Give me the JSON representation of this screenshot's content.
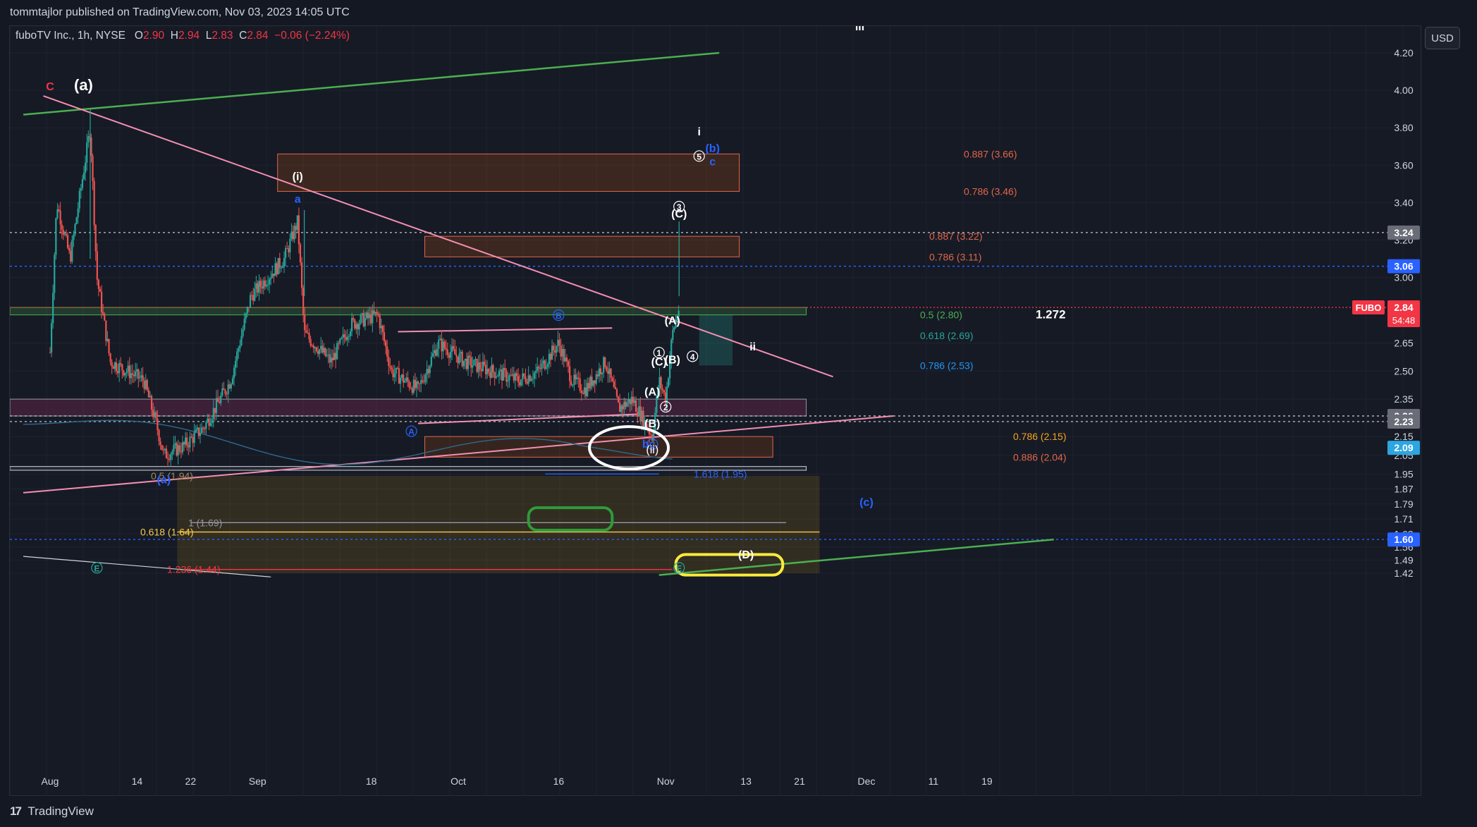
{
  "header": {
    "publish_line": "tommtajlor published on TradingView.com, Nov 03, 2023 14:05 UTC"
  },
  "footer": {
    "brand": "TradingView"
  },
  "toolbar": {
    "currency_label": "USD"
  },
  "legend": {
    "symbol": "fuboTV Inc., 1h, NYSE",
    "o_label": "O",
    "o_value": "2.90",
    "h_label": "H",
    "h_value": "2.94",
    "l_label": "L",
    "l_value": "2.83",
    "c_label": "C",
    "c_value": "2.84",
    "change": "−0.06 (−2.24%)"
  },
  "colors": {
    "background": "#161a25",
    "grid": "#1f2330",
    "text": "#d1d4dc",
    "candle_up": "#26a69a",
    "candle_down": "#ef5350",
    "trend_pink": "#f48fb1",
    "trend_green": "#4caf50",
    "fib_zone": "#ff6d00",
    "price_badge": "#f23645",
    "blue_level": "#2962ff"
  },
  "chart_data": {
    "type": "candlestick",
    "ylim": [
      1.4,
      4.4
    ],
    "y_ticks": [
      "1.42",
      "1.49",
      "1.56",
      "1.63",
      "1.71",
      "1.79",
      "1.87",
      "1.95",
      "2.05",
      "2.15",
      "2.23",
      "2.35",
      "2.50",
      "2.65",
      "3.00",
      "3.20",
      "3.40",
      "3.60",
      "3.80",
      "4.00",
      "4.20"
    ],
    "x_ticks": [
      "Aug",
      "14",
      "22",
      "Sep",
      "18",
      "Oct",
      "16",
      "Nov",
      "13",
      "21",
      "Dec",
      "11",
      "19"
    ],
    "ohlc_anchors": [
      {
        "t": "Aug 01",
        "p": 2.6
      },
      {
        "t": "Aug 02",
        "p": 3.4
      },
      {
        "t": "Aug 04",
        "p": 3.1
      },
      {
        "t": "Aug 07",
        "p": 3.8
      },
      {
        "t": "Aug 08",
        "p": 3.0
      },
      {
        "t": "Aug 10",
        "p": 2.55
      },
      {
        "t": "Aug 15",
        "p": 2.45
      },
      {
        "t": "Aug 17",
        "p": 2.2
      },
      {
        "t": "Aug 18",
        "p": 2.05
      },
      {
        "t": "Aug 21",
        "p": 2.1
      },
      {
        "t": "Aug 24",
        "p": 2.2
      },
      {
        "t": "Aug 28",
        "p": 2.45
      },
      {
        "t": "Aug 31",
        "p": 2.9
      },
      {
        "t": "Sep 05",
        "p": 3.1
      },
      {
        "t": "Sep 07",
        "p": 3.3
      },
      {
        "t": "Sep 08",
        "p": 2.7
      },
      {
        "t": "Sep 12",
        "p": 2.55
      },
      {
        "t": "Sep 15",
        "p": 2.75
      },
      {
        "t": "Sep 19",
        "p": 2.8
      },
      {
        "t": "Sep 21",
        "p": 2.5
      },
      {
        "t": "Sep 25",
        "p": 2.4
      },
      {
        "t": "Sep 28",
        "p": 2.65
      },
      {
        "t": "Oct 02",
        "p": 2.55
      },
      {
        "t": "Oct 06",
        "p": 2.5
      },
      {
        "t": "Oct 10",
        "p": 2.45
      },
      {
        "t": "Oct 13",
        "p": 2.5
      },
      {
        "t": "Oct 16",
        "p": 2.65
      },
      {
        "t": "Oct 18",
        "p": 2.45
      },
      {
        "t": "Oct 20",
        "p": 2.4
      },
      {
        "t": "Oct 23",
        "p": 2.55
      },
      {
        "t": "Oct 25",
        "p": 2.3
      },
      {
        "t": "Oct 27",
        "p": 2.35
      },
      {
        "t": "Oct 30",
        "p": 2.15
      },
      {
        "t": "Oct 31",
        "p": 2.45
      },
      {
        "t": "Nov 01",
        "p": 2.35
      },
      {
        "t": "Nov 02",
        "p": 2.7
      },
      {
        "t": "Nov 03",
        "p": 2.84
      }
    ],
    "price_labels": [
      {
        "value": 3.24,
        "label": "3.24",
        "style": "gray"
      },
      {
        "value": 3.06,
        "label": "3.06",
        "style": "blue"
      },
      {
        "value": 2.84,
        "label": "2.84",
        "style": "red",
        "symbol": "FUBO",
        "countdown": "54:48"
      },
      {
        "value": 2.26,
        "label": "2.26",
        "style": "gray"
      },
      {
        "value": 2.23,
        "label": "2.23",
        "style": "gray"
      },
      {
        "value": 2.09,
        "label": "2.09",
        "style": "cyan"
      },
      {
        "value": 1.6,
        "label": "1.60",
        "style": "blue"
      }
    ],
    "fib_labels": [
      {
        "text": "0.887 (3.66)",
        "value": 3.66,
        "color": "#e0664a"
      },
      {
        "text": "0.786 (3.46)",
        "value": 3.46,
        "color": "#e0664a"
      },
      {
        "text": "0.887 (3.22)",
        "value": 3.22,
        "color": "#e0664a"
      },
      {
        "text": "0.786 (3.11)",
        "value": 3.11,
        "color": "#e0664a"
      },
      {
        "text": "0.5 (2.80)",
        "value": 2.8,
        "color": "#4caf50"
      },
      {
        "text": "1.272",
        "value": 2.8,
        "color": "#ffffff"
      },
      {
        "text": "0.618 (2.69)",
        "value": 2.69,
        "color": "#26a69a"
      },
      {
        "text": "0.786 (2.53)",
        "value": 2.53,
        "color": "#2196f3"
      },
      {
        "text": "0.786 (2.15)",
        "value": 2.15,
        "color": "#f7a21b"
      },
      {
        "text": "0.886 (2.04)",
        "value": 2.04,
        "color": "#e0664a"
      },
      {
        "text": "1.618 (1.95)",
        "value": 1.95,
        "color": "#2962ff"
      },
      {
        "text": "0.5 (1.94)",
        "value": 1.94,
        "color": "#a28a5a"
      },
      {
        "text": "1 (1.69)",
        "value": 1.69,
        "color": "#9598a1"
      },
      {
        "text": "0.618 (1.64)",
        "value": 1.64,
        "color": "#f7c948"
      },
      {
        "text": "1.236 (1.44)",
        "value": 1.44,
        "color": "#f23645"
      }
    ],
    "wave_labels": [
      {
        "text": "C",
        "t": "Aug 01",
        "p": 4.0,
        "color": "#f23645"
      },
      {
        "text": "(a)",
        "t": "Aug 06",
        "p": 4.0,
        "color": "#ffffff"
      },
      {
        "text": "(i)",
        "t": "Sep 07",
        "p": 3.52,
        "color": "#ffffff"
      },
      {
        "text": "a",
        "t": "Sep 07",
        "p": 3.4,
        "color": "#2962ff"
      },
      {
        "text": "i",
        "t": "Nov 06",
        "p": 3.76,
        "color": "#ffffff"
      },
      {
        "text": "5",
        "t": "Nov 06",
        "p": 3.63,
        "color": "#ffffff"
      },
      {
        "text": "(b)",
        "t": "Nov 08",
        "p": 3.67,
        "color": "#2962ff"
      },
      {
        "text": "c",
        "t": "Nov 08",
        "p": 3.6,
        "color": "#2962ff"
      },
      {
        "text": "iii",
        "t": "Nov 30",
        "p": 4.32,
        "color": "#ffffff"
      },
      {
        "text": "3",
        "t": "Nov 03",
        "p": 3.36,
        "color": "#ffffff"
      },
      {
        "text": "(C)",
        "t": "Nov 03",
        "p": 3.32,
        "color": "#ffffff"
      },
      {
        "text": "B",
        "t": "Oct 16",
        "p": 2.78,
        "color": "#2962ff"
      },
      {
        "text": "(A)",
        "t": "Nov 02",
        "p": 2.75,
        "color": "#ffffff"
      },
      {
        "text": "ii",
        "t": "Nov 14",
        "p": 2.61,
        "color": "#ffffff"
      },
      {
        "text": "1",
        "t": "Oct 31",
        "p": 2.58,
        "color": "#ffffff"
      },
      {
        "text": "(C)",
        "t": "Oct 31",
        "p": 2.53,
        "color": "#ffffff"
      },
      {
        "text": "(B)",
        "t": "Nov 02",
        "p": 2.54,
        "color": "#ffffff"
      },
      {
        "text": "4",
        "t": "Nov 05",
        "p": 2.56,
        "color": "#ffffff"
      },
      {
        "text": "(A)",
        "t": "Oct 30",
        "p": 2.37,
        "color": "#ffffff"
      },
      {
        "text": "2",
        "t": "Nov 01",
        "p": 2.29,
        "color": "#ffffff"
      },
      {
        "text": "(B)",
        "t": "Oct 30",
        "p": 2.2,
        "color": "#ffffff"
      },
      {
        "text": "A",
        "t": "Sep 24",
        "p": 2.16,
        "color": "#2962ff"
      },
      {
        "text": "b",
        "t": "Oct 29",
        "p": 2.09,
        "color": "#2962ff"
      },
      {
        "text": "C",
        "t": "Oct 30",
        "p": 2.09,
        "color": "#2962ff"
      },
      {
        "text": "(ii)",
        "t": "Oct 30",
        "p": 2.06,
        "color": "#ffffff"
      },
      {
        "text": "(a)",
        "t": "Aug 18",
        "p": 1.9,
        "color": "#2962ff"
      },
      {
        "text": "(c)",
        "t": "Dec 01",
        "p": 1.78,
        "color": "#2962ff"
      },
      {
        "text": "(D)",
        "t": "Nov 13",
        "p": 1.5,
        "color": "#ffffff"
      },
      {
        "text": "E",
        "t": "Aug 08",
        "p": 1.43,
        "color": "#26a69a"
      },
      {
        "text": "E",
        "t": "Nov 03",
        "p": 1.43,
        "color": "#26a69a"
      }
    ]
  }
}
